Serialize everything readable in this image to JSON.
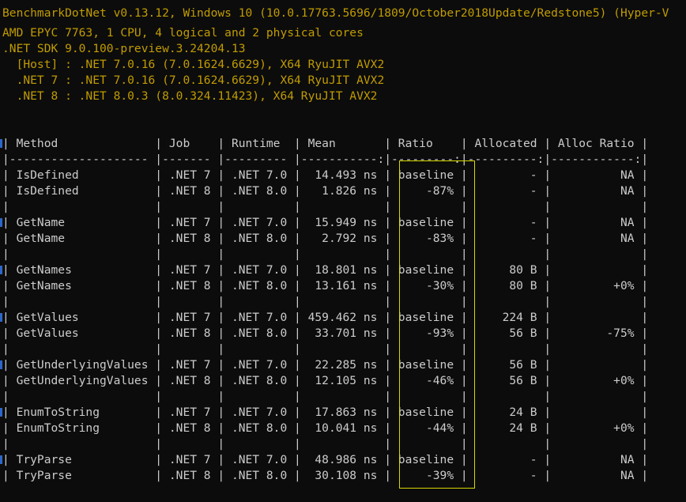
{
  "header": [
    "BenchmarkDotNet v0.13.12, Windows 10 (10.0.17763.5696/1809/October2018Update/Redstone5) (Hyper-V",
    "AMD EPYC 7763, 1 CPU, 4 logical and 2 physical cores",
    ".NET SDK 9.0.100-preview.3.24204.13",
    "  [Host] : .NET 7.0.16 (7.0.1624.6629), X64 RyuJIT AVX2",
    "  .NET 7 : .NET 7.0.16 (7.0.1624.6629), X64 RyuJIT AVX2",
    "  .NET 8 : .NET 8.0.3 (8.0.324.11423), X64 RyuJIT AVX2"
  ],
  "table": {
    "header_line": "| Method              | Job    | Runtime  | Mean       | Ratio    | Allocated | Alloc Ratio |",
    "separator_line": "|-------------------- |------- |--------- |-----------:|---------:|----------:|------------:|",
    "blank_line": "|                     |        |          |            |          |           |             |",
    "rows": [
      "| IsDefined           | .NET 7 | .NET 7.0 |  14.493 ns | baseline |         - |          NA |",
      "| IsDefined           | .NET 8 | .NET 8.0 |   1.826 ns |     -87% |         - |          NA |",
      "| GetName             | .NET 7 | .NET 7.0 |  15.949 ns | baseline |         - |          NA |",
      "| GetName             | .NET 8 | .NET 8.0 |   2.792 ns |     -83% |         - |          NA |",
      "| GetNames            | .NET 7 | .NET 7.0 |  18.801 ns | baseline |      80 B |             |",
      "| GetNames            | .NET 8 | .NET 8.0 |  13.161 ns |     -30% |      80 B |         +0% |",
      "| GetValues           | .NET 7 | .NET 7.0 | 459.462 ns | baseline |     224 B |             |",
      "| GetValues           | .NET 8 | .NET 8.0 |  33.701 ns |     -93% |      56 B |        -75% |",
      "| GetUnderlyingValues | .NET 7 | .NET 7.0 |  22.285 ns | baseline |      56 B |             |",
      "| GetUnderlyingValues | .NET 8 | .NET 8.0 |  12.105 ns |     -46% |      56 B |         +0% |",
      "| EnumToString        | .NET 7 | .NET 7.0 |  17.863 ns | baseline |      24 B |             |",
      "| EnumToString        | .NET 8 | .NET 8.0 |  10.041 ns |     -44% |      24 B |         +0% |",
      "| TryParse            | .NET 7 | .NET 7.0 |  48.986 ns | baseline |         - |          NA |",
      "| TryParse            | .NET 8 | .NET 8.0 |  30.108 ns |     -39% |         - |          NA |"
    ]
  },
  "colors": {
    "background": "#0c0c0c",
    "header_text": "#c19c00",
    "table_text": "#cccccc",
    "highlight_border": "#d7d700"
  }
}
